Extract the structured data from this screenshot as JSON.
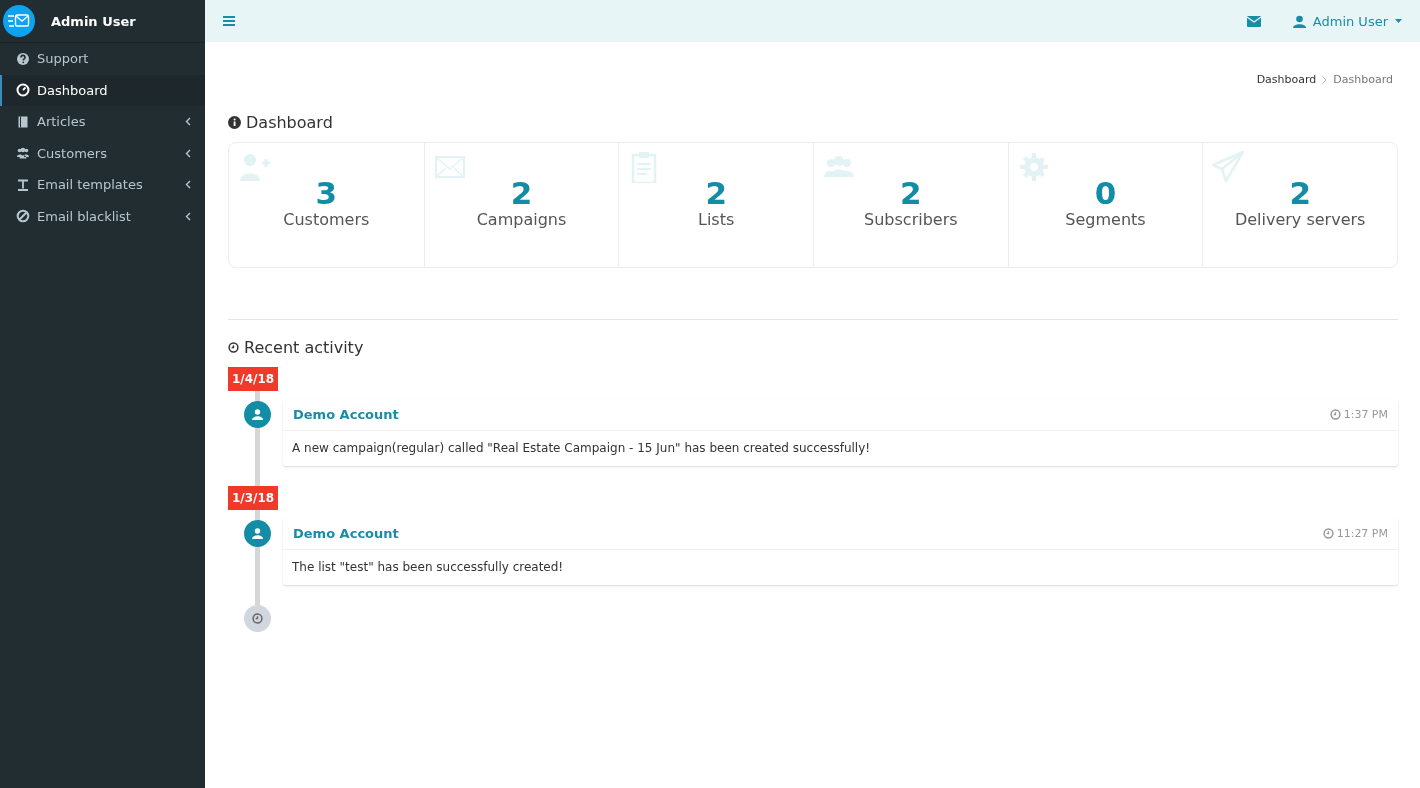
{
  "sidebar": {
    "user_name": "Admin User",
    "items": [
      {
        "label": "Support",
        "selected": false,
        "expandable": false
      },
      {
        "label": "Dashboard",
        "selected": true,
        "expandable": false
      },
      {
        "label": "Articles",
        "selected": false,
        "expandable": true
      },
      {
        "label": "Customers",
        "selected": false,
        "expandable": true
      },
      {
        "label": "Email templates",
        "selected": false,
        "expandable": true
      },
      {
        "label": "Email blacklist",
        "selected": false,
        "expandable": true
      }
    ]
  },
  "topbar": {
    "user_menu": "Admin User"
  },
  "breadcrumb": [
    "Dashboard",
    "Dashboard"
  ],
  "page_title": "Dashboard",
  "stats": [
    {
      "value": "3",
      "label": "Customers"
    },
    {
      "value": "2",
      "label": "Campaigns"
    },
    {
      "value": "2",
      "label": "Lists"
    },
    {
      "value": "2",
      "label": "Subscribers"
    },
    {
      "value": "0",
      "label": "Segments"
    },
    {
      "value": "2",
      "label": "Delivery servers"
    }
  ],
  "activity": {
    "title": "Recent activity",
    "groups": [
      {
        "date": "1/4/18",
        "entries": [
          {
            "author": "Demo Account",
            "time": "1:37 PM",
            "message": "A new campaign(regular) called \"Real Estate Campaign - 15 Jun\" has been created successfully!"
          }
        ]
      },
      {
        "date": "1/3/18",
        "entries": [
          {
            "author": "Demo Account",
            "time": "11:27 PM",
            "message": "The list \"test\" has been successfully created!"
          }
        ]
      }
    ]
  }
}
